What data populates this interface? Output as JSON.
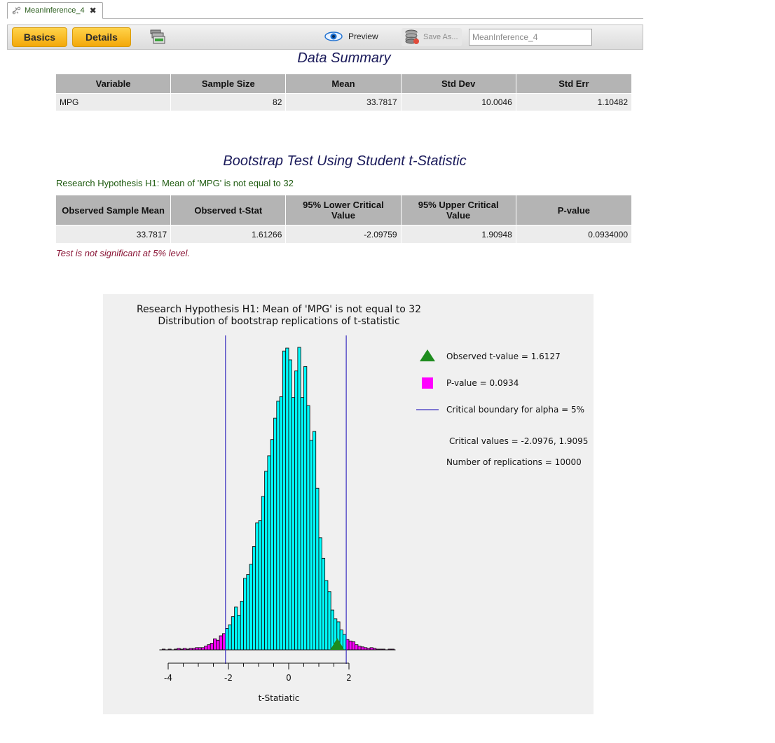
{
  "tab": {
    "label": "MeanInference_4"
  },
  "toolbar": {
    "basics_label": "Basics",
    "details_label": "Details",
    "preview_label": "Preview",
    "saveas_label": "Save As...",
    "name_value": "MeanInference_4"
  },
  "summary": {
    "title": "Data Summary",
    "headers": [
      "Variable",
      "Sample Size",
      "Mean",
      "Std Dev",
      "Std Err"
    ],
    "row": [
      "MPG",
      "82",
      "33.7817",
      "10.0046",
      "1.10482"
    ]
  },
  "bootstrap": {
    "title": "Bootstrap Test Using Student t-Statistic",
    "hypothesis": "Research Hypothesis H1: Mean of 'MPG' is not equal to 32",
    "headers": [
      "Observed Sample Mean",
      "Observed t-Stat",
      "95% Lower Critical Value",
      "95% Upper Critical Value",
      "P-value"
    ],
    "row": [
      "33.7817",
      "1.61266",
      "-2.09759",
      "1.90948",
      "0.0934000"
    ],
    "significance": "Test is not significant at 5% level."
  },
  "colors": {
    "bar_inner": "#00ffff",
    "bar_tail": "#ff00ff",
    "observed_marker": "#1e8c1e",
    "critical_line": "#3a2fc0"
  },
  "chart_data": {
    "type": "bar",
    "title": "Research Hypothesis H1: Mean of 'MPG' is not equal to 32",
    "subtitle": "Distribution of bootstrap replications of t-statistic",
    "xlabel": "t-Statiatic",
    "ylabel": "",
    "xlim": [
      -4.3,
      3.8
    ],
    "x_ticks": [
      -4,
      -2,
      0,
      2
    ],
    "bin_start": -4.2,
    "bin_width": 0.1,
    "counts": [
      1,
      0,
      1,
      0,
      1,
      2,
      1,
      2,
      1,
      2,
      2,
      3,
      3,
      3,
      5,
      7,
      9,
      15,
      13,
      19,
      22,
      29,
      34,
      45,
      58,
      47,
      66,
      97,
      102,
      116,
      140,
      172,
      175,
      208,
      242,
      263,
      285,
      314,
      337,
      343,
      405,
      409,
      393,
      342,
      378,
      410,
      342,
      384,
      331,
      284,
      296,
      219,
      152,
      124,
      94,
      79,
      54,
      42,
      38,
      27,
      21,
      14,
      12,
      11,
      7,
      5,
      4,
      3,
      2,
      3,
      2,
      1,
      1,
      1,
      0,
      1,
      1
    ],
    "critical_values": [
      -2.0976,
      1.9095
    ],
    "observed_t": 1.6127,
    "legend": [
      {
        "marker": "triangle",
        "label": "Observed t-value = 1.6127"
      },
      {
        "marker": "square",
        "label": "P-value = 0.0934"
      },
      {
        "marker": "line",
        "label": "Critical boundary for  alpha  =  5%"
      }
    ],
    "annotations": [
      "Critical values = -2.0976, 1.9095",
      "Number of replications = 10000"
    ],
    "legend_position": "right",
    "grid": false
  }
}
